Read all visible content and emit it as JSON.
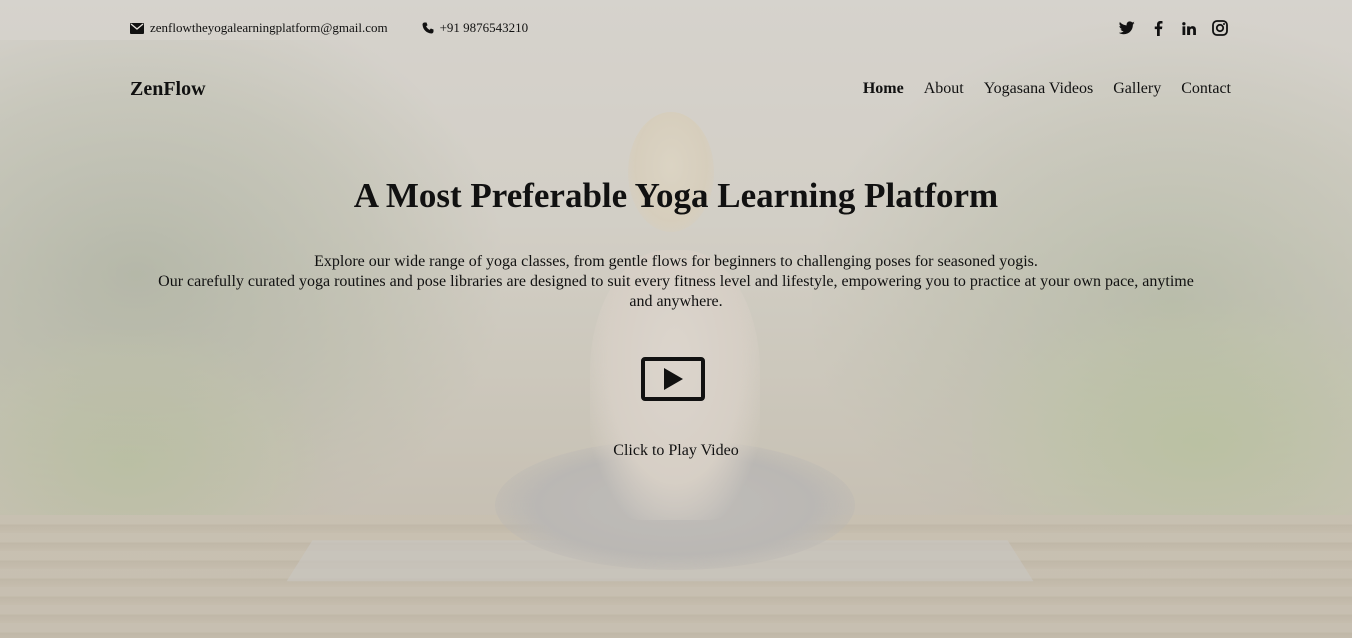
{
  "topbar": {
    "email": "zenflowtheyogalearningplatform@gmail.com",
    "phone": "+91 9876543210",
    "email_icon": "envelope-icon",
    "phone_icon": "phone-icon",
    "social": [
      {
        "name": "twitter-icon"
      },
      {
        "name": "facebook-icon"
      },
      {
        "name": "linkedin-icon"
      },
      {
        "name": "instagram-icon"
      }
    ]
  },
  "nav": {
    "brand": "ZenFlow",
    "links": [
      {
        "label": "Home",
        "active": true
      },
      {
        "label": "About",
        "active": false
      },
      {
        "label": "Yogasana Videos",
        "active": false
      },
      {
        "label": "Gallery",
        "active": false
      },
      {
        "label": "Contact",
        "active": false
      }
    ]
  },
  "hero": {
    "title": "A Most Preferable Yoga Learning Platform",
    "description_line1": "Explore our wide range of yoga classes, from gentle flows for beginners to challenging poses for seasoned yogis.",
    "description_line2": "Our carefully curated yoga routines and pose libraries are designed to suit every fitness level and lifestyle, empowering you to practice at your own pace, anytime and anywhere.",
    "play_icon": "play-icon",
    "play_label": "Click to Play Video"
  },
  "colors": {
    "text": "#111111",
    "overlay": "#e1deda"
  }
}
